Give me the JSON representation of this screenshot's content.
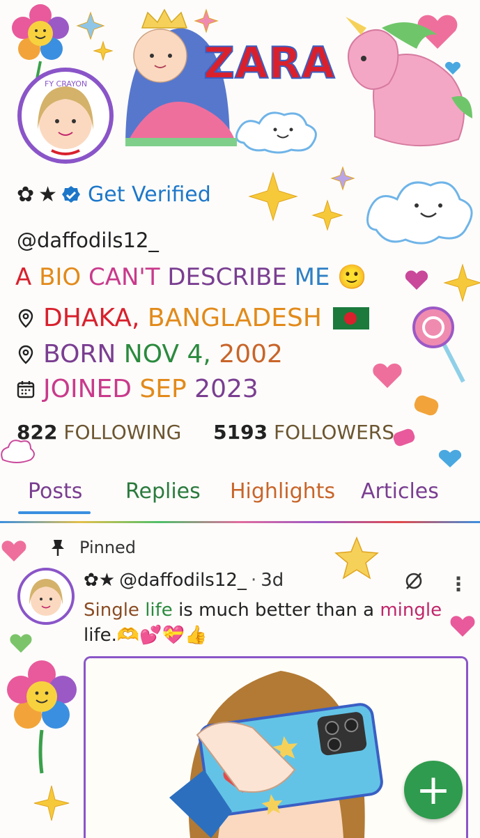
{
  "header": {
    "banner_title": "ZARA",
    "avatar_caption": "FY CRAYON"
  },
  "profile": {
    "badges": [
      "✿",
      "★"
    ],
    "verify_label": "Get Verified",
    "handle": "@daffodils12_",
    "bio": [
      "A ",
      "BIO ",
      "CAN'T ",
      "DESCRIBE ",
      "ME "
    ],
    "bio_emoji": "🙂",
    "location_parts": [
      "DHAKA, ",
      "BANGLADESH"
    ],
    "born_parts": [
      "BORN ",
      "NOV 4, ",
      "2002"
    ],
    "joined_parts": [
      "JOINED ",
      "SEP ",
      "2023"
    ],
    "following_count": "822",
    "following_label": "FOLLOWING",
    "followers_count": "5193",
    "followers_label": "FOLLOWERS"
  },
  "tabs": [
    {
      "label": "Posts",
      "color": "#7a3e91"
    },
    {
      "label": "Replies",
      "color": "#2b7a3e"
    },
    {
      "label": "Highlights",
      "color": "#c8652a"
    },
    {
      "label": "Articles",
      "color": "#7a3e91"
    }
  ],
  "pinned_post": {
    "pinned_label": "Pinned",
    "author_badges": "✿★",
    "author_handle": "@daffodils12_",
    "separator": "·",
    "time": "3d",
    "text_parts": [
      "Single ",
      "life",
      " is much better than a ",
      "mingle",
      " life."
    ],
    "text_emoji": "🫶💕💝👍"
  },
  "fab_label": "+",
  "colors": {
    "verified_blue": "#1d77c9",
    "bio_a": "#d8212d",
    "bio_bio": "#e28a1a",
    "bio_cant": "#c93a8b",
    "bio_describe": "#7a3e91",
    "bio_me": "#2f7fc4",
    "fab_green": "#2f9b4e"
  }
}
